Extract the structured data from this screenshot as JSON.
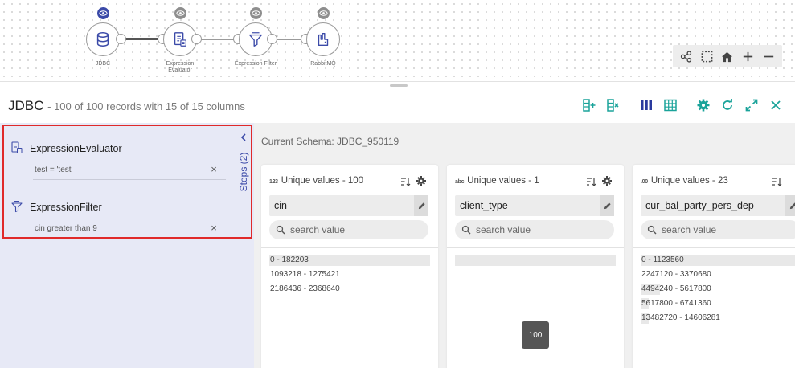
{
  "pipeline": {
    "nodes": [
      {
        "label": "JDBC",
        "active": true
      },
      {
        "label": "Expression Evaluator",
        "active": false
      },
      {
        "label": "Expression Filter",
        "active": false
      },
      {
        "label": "RabbitMQ",
        "active": false
      }
    ],
    "controls": [
      "share-nodes-icon",
      "select-box-icon",
      "home-icon",
      "zoom-in-icon",
      "zoom-out-icon"
    ]
  },
  "header": {
    "title": "JDBC",
    "subtitle": "- 100 of 100 records with 15 of 15 columns",
    "toolbar": [
      "add-column-icon",
      "remove-column-icon",
      "columns-view-icon",
      "table-view-icon",
      "settings-icon",
      "refresh-icon",
      "expand-icon",
      "close-icon"
    ],
    "accent_color": "#1aa39a"
  },
  "steps": {
    "label": "Steps (2)",
    "items": [
      {
        "title": "ExpressionEvaluator",
        "description": "test = 'test'",
        "close": "×"
      },
      {
        "title": "ExpressionFilter",
        "description": "cin greater than 9",
        "close": "×"
      }
    ]
  },
  "schema": {
    "label": "Current Schema: JDBC_950119"
  },
  "columns": [
    {
      "type_tag": "123",
      "unique": "Unique values - 100",
      "name": "cin",
      "search_placeholder": "search value",
      "ranges": [
        {
          "text": "0 - 182203",
          "fraction": 1.0
        },
        {
          "text": "1093218 - 1275421",
          "fraction": 0.0
        },
        {
          "text": "2186436 - 2368640",
          "fraction": 0.0
        }
      ]
    },
    {
      "type_tag": "abc",
      "unique": "Unique values - 1",
      "name": "client_type",
      "search_placeholder": "search value",
      "ranges": [
        {
          "text": "",
          "fraction": 1.0
        }
      ],
      "tooltip": "100"
    },
    {
      "type_tag": ".00",
      "unique": "Unique values - 23",
      "name": "cur_bal_party_pers_dep",
      "search_placeholder": "search value",
      "ranges": [
        {
          "text": "0 - 1123560",
          "fraction": 1.0
        },
        {
          "text": "2247120 - 3370680",
          "fraction": 0.0
        },
        {
          "text": "4494240 - 5617800",
          "fraction": 0.12
        },
        {
          "text": "5617800 - 6741360",
          "fraction": 0.05
        },
        {
          "text": "13482720 - 14606281",
          "fraction": 0.05
        }
      ]
    }
  ]
}
